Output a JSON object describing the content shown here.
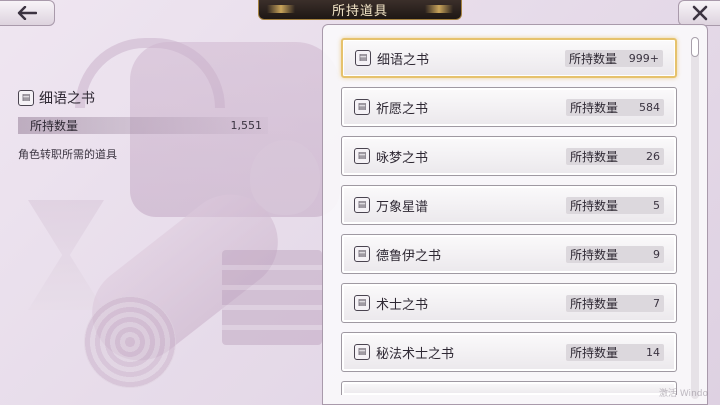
{
  "header": {
    "title": "所持道具"
  },
  "detail": {
    "name": "细语之书",
    "qty_label": "所持数量",
    "qty_value": "1,551",
    "description": "角色转职所需的道具"
  },
  "items": [
    {
      "name": "细语之书",
      "qty_label": "所持数量",
      "qty": "999+",
      "selected": true
    },
    {
      "name": "祈愿之书",
      "qty_label": "所持数量",
      "qty": "584"
    },
    {
      "name": "咏梦之书",
      "qty_label": "所持数量",
      "qty": "26"
    },
    {
      "name": "万象星谱",
      "qty_label": "所持数量",
      "qty": "5"
    },
    {
      "name": "德鲁伊之书",
      "qty_label": "所持数量",
      "qty": "9"
    },
    {
      "name": "术士之书",
      "qty_label": "所持数量",
      "qty": "7"
    },
    {
      "name": "秘法术士之书",
      "qty_label": "所持数量",
      "qty": "14"
    }
  ],
  "icons": {
    "back": "arrow-left-icon",
    "close": "close-icon",
    "item": "book-icon"
  },
  "watermark": "激活 Windo"
}
